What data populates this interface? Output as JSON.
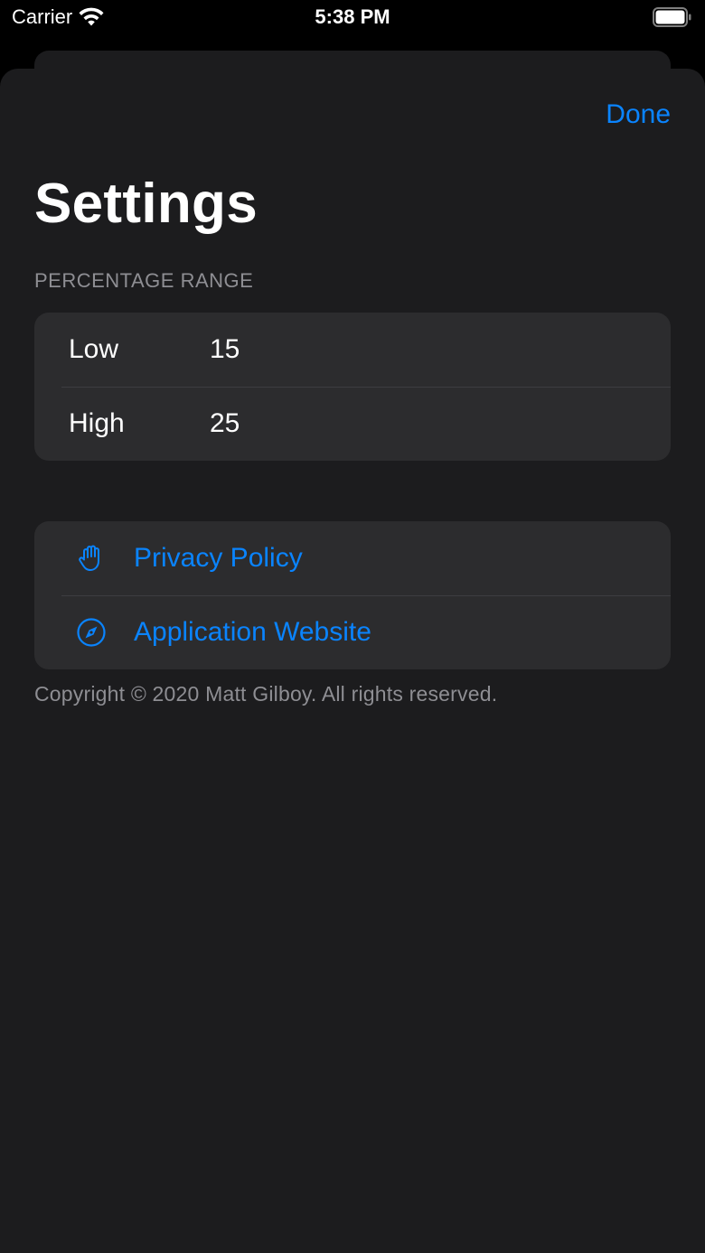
{
  "status_bar": {
    "carrier": "Carrier",
    "time": "5:38 PM"
  },
  "header": {
    "done_label": "Done",
    "title": "Settings"
  },
  "percentage_range": {
    "section_title": "PERCENTAGE RANGE",
    "rows": [
      {
        "label": "Low",
        "value": "15"
      },
      {
        "label": "High",
        "value": "25"
      }
    ]
  },
  "links": [
    {
      "label": "Privacy Policy",
      "icon": "hand-icon"
    },
    {
      "label": "Application Website",
      "icon": "compass-icon"
    }
  ],
  "footer": {
    "copyright": "Copyright © 2020 Matt Gilboy. All rights reserved."
  },
  "colors": {
    "accent": "#0a84ff",
    "sheet_background": "#1c1c1e",
    "group_background": "#2c2c2e",
    "secondary_text": "#8e8e93"
  }
}
